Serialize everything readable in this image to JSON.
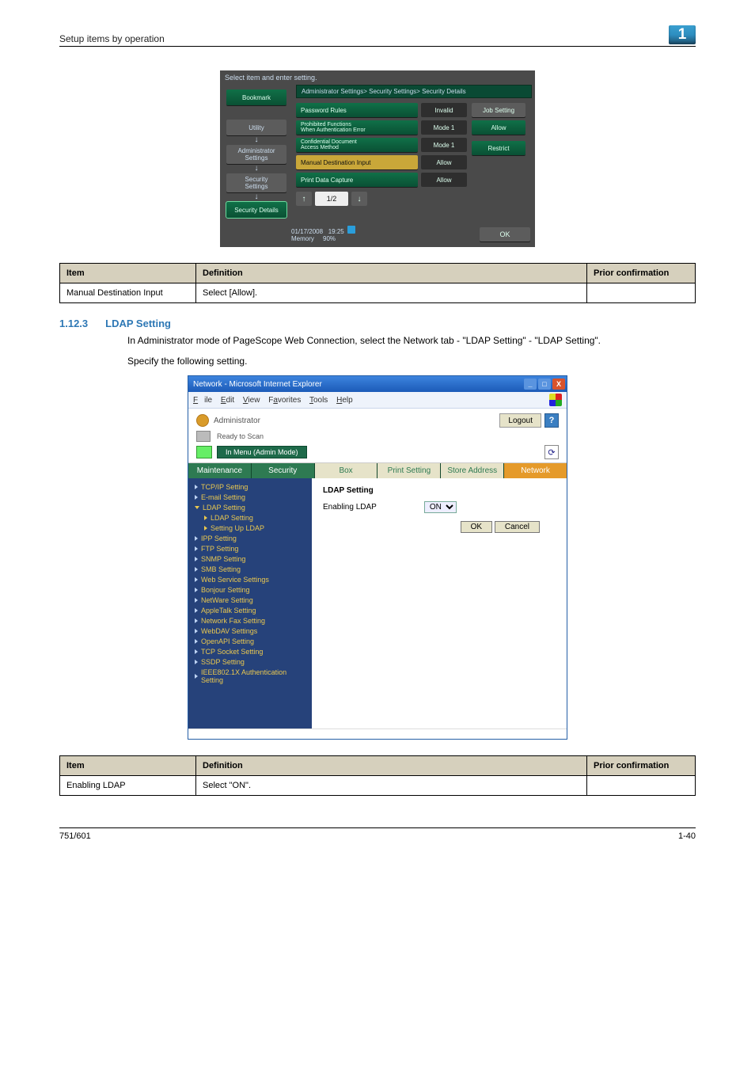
{
  "header_left": "Setup items by operation",
  "badge": "1",
  "panel": {
    "top_instruction": "Select item and enter setting.",
    "breadcrumb": "Administrator Settings> Security Settings> Security Details",
    "side": {
      "bookmark": "Bookmark",
      "utility": "Utility",
      "admin": "Administrator\nSettings",
      "security": "Security\nSettings",
      "details": "Security Details"
    },
    "right": {
      "job_setting": "Job Setting",
      "allow": "Allow",
      "restrict": "Restrict"
    },
    "rows": {
      "password_rules": "Password Rules",
      "password_rules_v": "Invalid",
      "prohibited1": "Prohibited Functions",
      "prohibited2": "When Authentication Error",
      "prohibited_v": "Mode 1",
      "confidential1": "Confidential Document",
      "confidential2": "Access Method",
      "confidential_v": "Mode 1",
      "manual_dest": "Manual Destination Input",
      "manual_dest_v": "Allow",
      "print_capture": "Print Data Capture",
      "print_capture_v": "Allow"
    },
    "pager": {
      "up": "↑",
      "ind": "1/2",
      "down": "↓"
    },
    "footer": {
      "date": "01/17/2008",
      "time": "19:25",
      "mem_label": "Memory",
      "mem_val": "90%",
      "ok": "OK"
    }
  },
  "table1": {
    "h1": "Item",
    "h2": "Definition",
    "h3": "Prior confirmation",
    "r1c1": "Manual Destination Input",
    "r1c2": "Select [Allow].",
    "r1c3": ""
  },
  "section": {
    "num": "1.12.3",
    "title": "LDAP Setting",
    "para1": "In Administrator mode of PageScope Web Connection, select the Network tab - \"LDAP Setting\" - \"LDAP Setting\".",
    "para2": "Specify the following setting."
  },
  "browser": {
    "title": "Network - Microsoft Internet Explorer",
    "menus": {
      "file": "File",
      "edit": "Edit",
      "view": "View",
      "fav": "Favorites",
      "tools": "Tools",
      "help": "Help"
    },
    "admin_role": "Administrator",
    "logout": "Logout",
    "ready": "Ready to Scan",
    "mode": "In Menu (Admin Mode)",
    "tabs": {
      "maintenance": "Maintenance",
      "security": "Security",
      "box": "Box",
      "print": "Print Setting",
      "store": "Store Address",
      "network": "Network"
    },
    "nav": {
      "tcpip": "TCP/IP Setting",
      "email": "E-mail Setting",
      "ldap": "LDAP Setting",
      "ldap_sub": "LDAP Setting",
      "ldap_sub2": "Setting Up LDAP",
      "ipp": "IPP Setting",
      "ftp": "FTP Setting",
      "snmp": "SNMP Setting",
      "smb": "SMB Setting",
      "wss": "Web Service Settings",
      "bonjour": "Bonjour Setting",
      "netware": "NetWare Setting",
      "appletalk": "AppleTalk Setting",
      "netfax": "Network Fax Setting",
      "webdav": "WebDAV Settings",
      "openapi": "OpenAPI Setting",
      "tcpsocket": "TCP Socket Setting",
      "ssdp": "SSDP Setting",
      "ieee": "IEEE802.1X Authentication Setting"
    },
    "content": {
      "heading": "LDAP Setting",
      "field": "Enabling LDAP",
      "value": "ON",
      "ok": "OK",
      "cancel": "Cancel"
    }
  },
  "table2": {
    "h1": "Item",
    "h2": "Definition",
    "h3": "Prior confirmation",
    "r1c1": "Enabling LDAP",
    "r1c2": "Select \"ON\".",
    "r1c3": ""
  },
  "footer": {
    "left": "751/601",
    "right": "1-40"
  }
}
